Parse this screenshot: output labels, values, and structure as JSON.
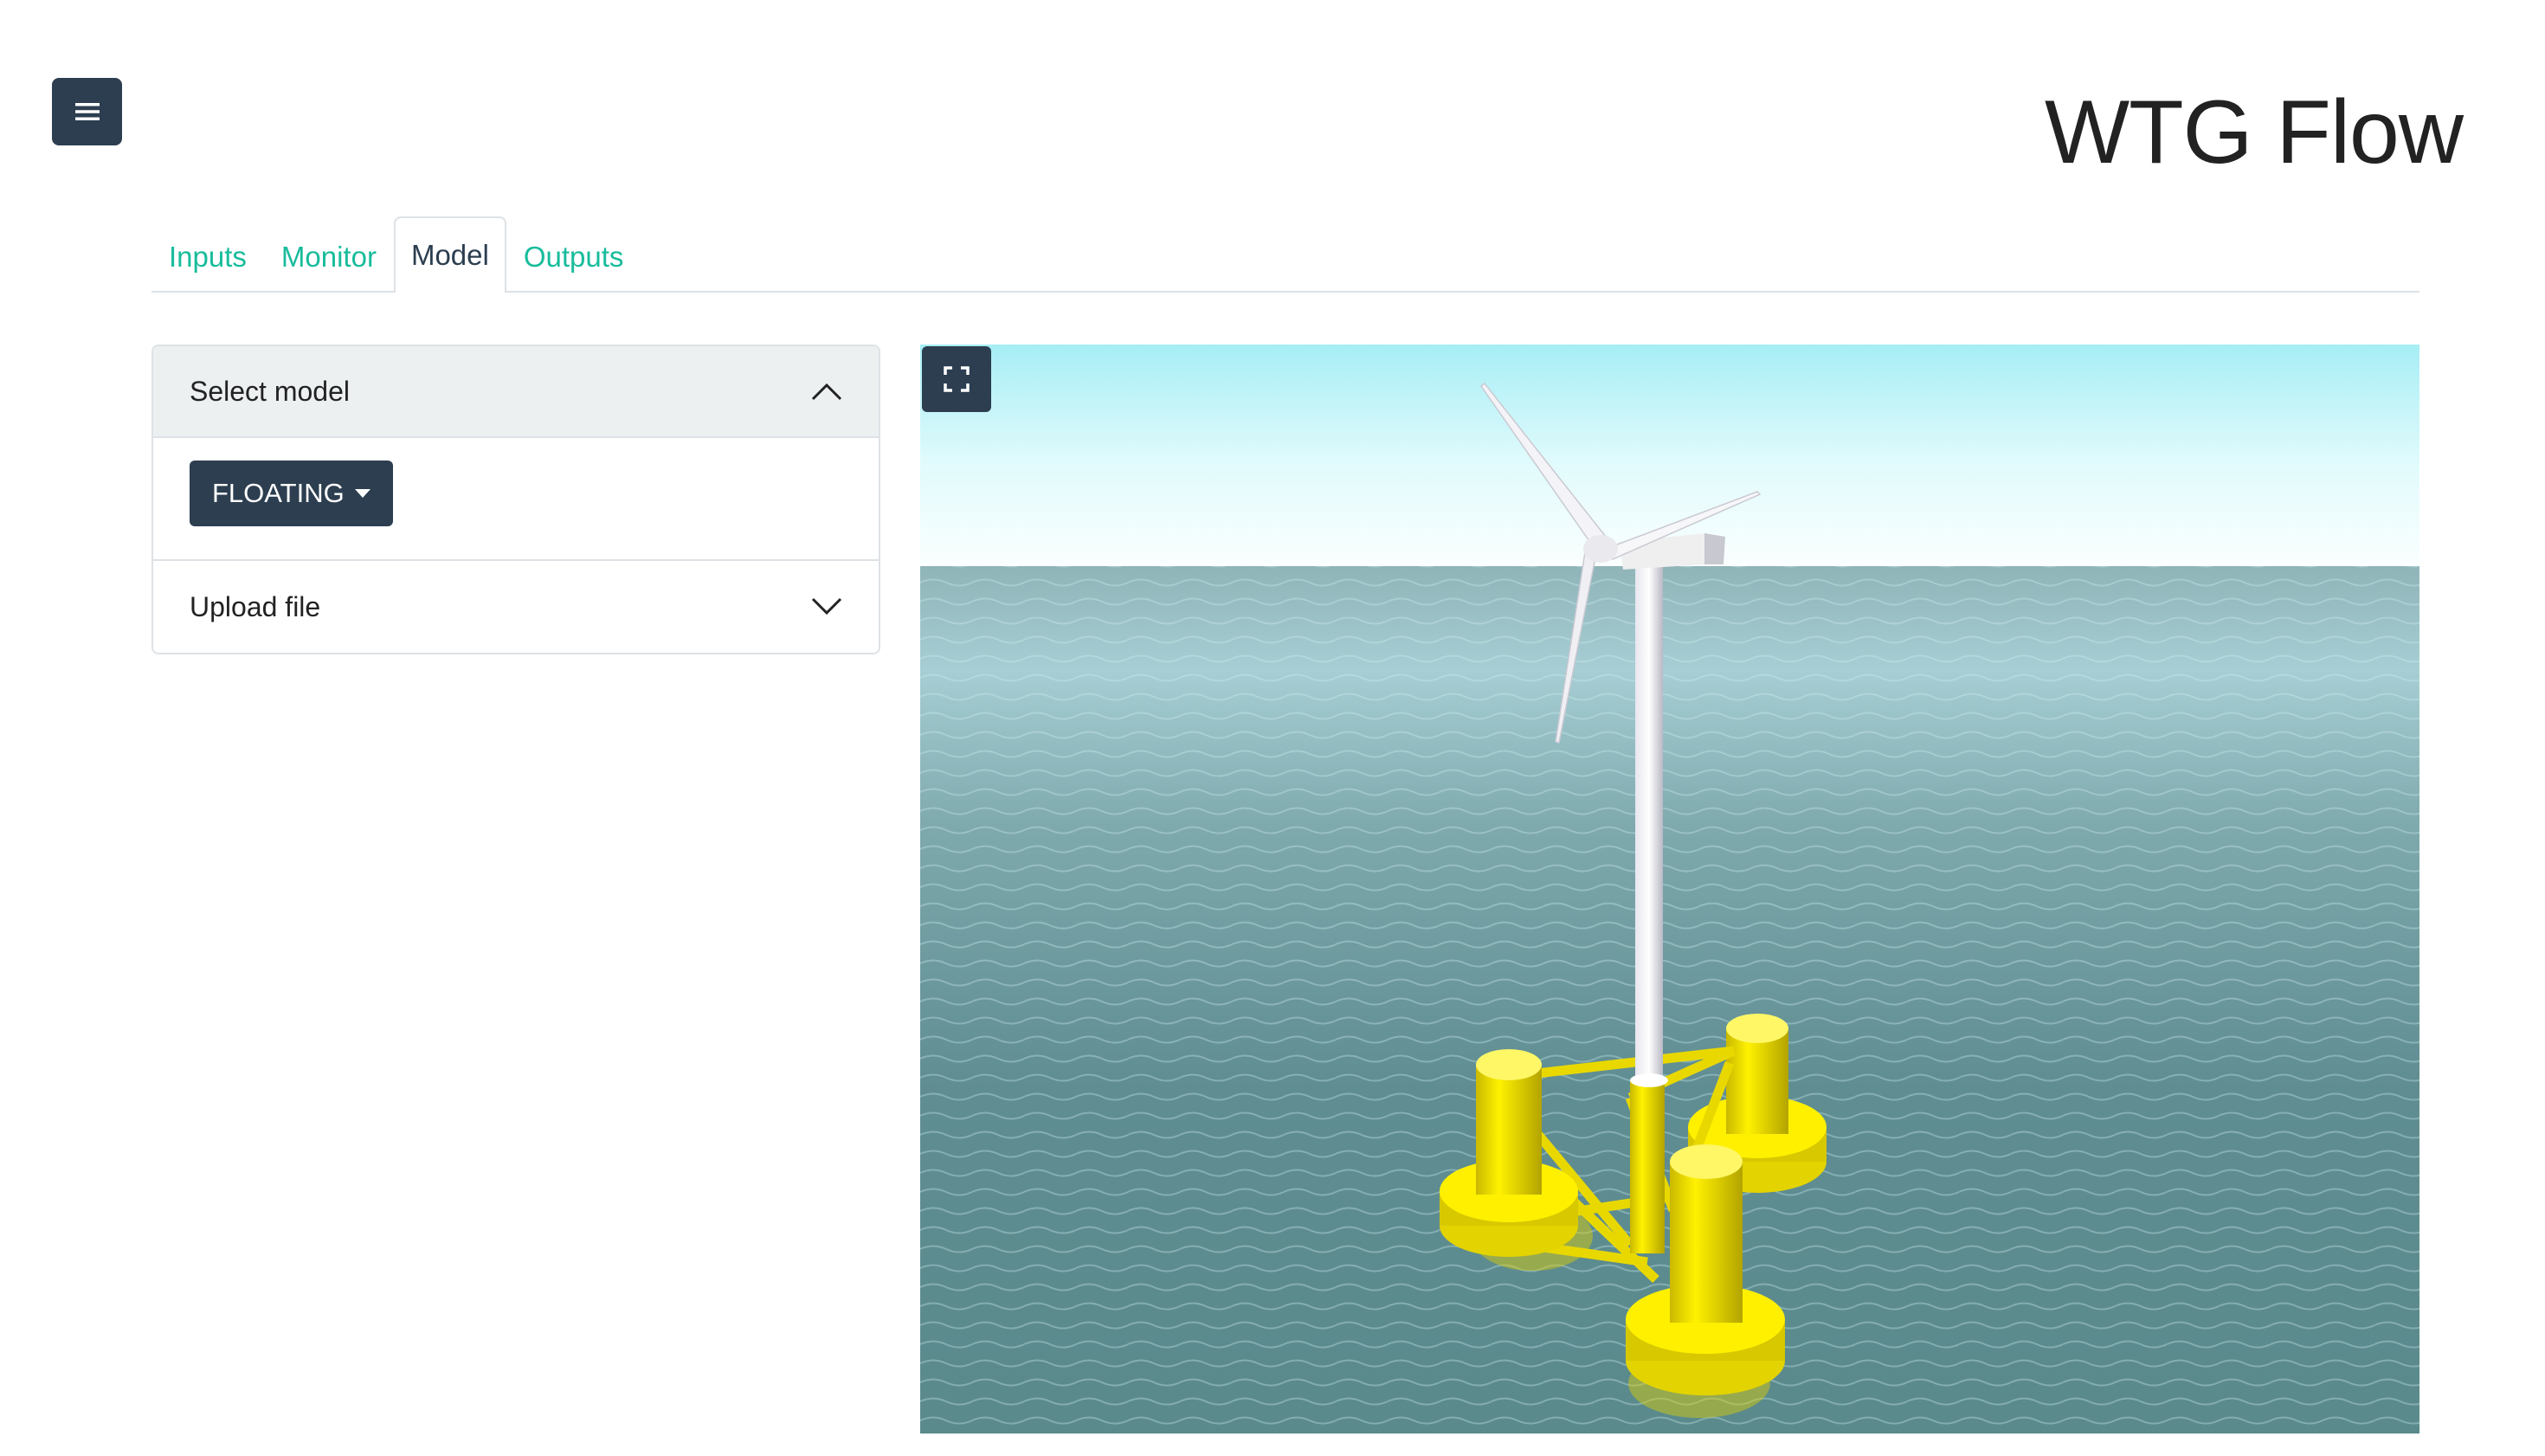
{
  "app": {
    "title": "WTG Flow"
  },
  "tabs": [
    {
      "label": "Inputs",
      "active": false
    },
    {
      "label": "Monitor",
      "active": false
    },
    {
      "label": "Model",
      "active": true
    },
    {
      "label": "Outputs",
      "active": false
    }
  ],
  "model_panel": {
    "select_header": "Select model",
    "select_expanded": true,
    "model_value": "FLOATING",
    "upload_header": "Upload file",
    "upload_expanded": false
  },
  "viewer": {
    "scene": "floating-wind-turbine-3d",
    "fullscreen_icon": "expand-icon"
  },
  "colors": {
    "primary": "#2c3e50",
    "accent": "#18bc9c",
    "platform": "#f2e600",
    "tower": "#f0f0f4",
    "sea": "#5d8b90",
    "sky": "#a9f0f5"
  },
  "icons": {
    "menu": "hamburger-icon",
    "collapse": "chevron-up-icon",
    "expand": "chevron-down-icon",
    "dropdown": "caret-down-icon"
  }
}
